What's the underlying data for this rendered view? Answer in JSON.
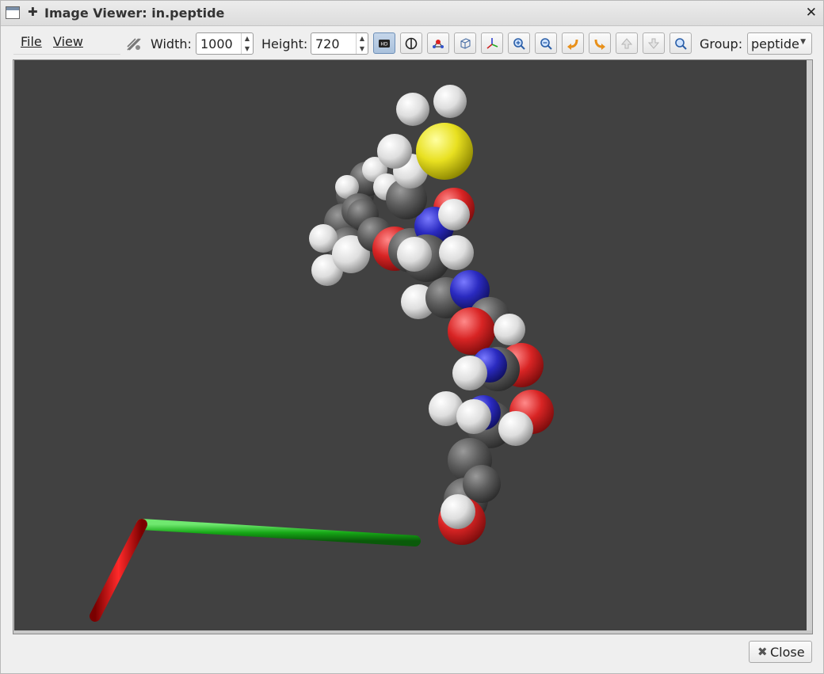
{
  "window": {
    "title": "Image Viewer: in.peptide"
  },
  "menu": {
    "file": "File",
    "view": "View"
  },
  "toolbar": {
    "width_label": "Width:",
    "width_value": "1000",
    "height_label": "Height:",
    "height_value": "720",
    "group_label": "Group:",
    "group_value": "peptide",
    "buttons": [
      "hd-icon",
      "contrast-icon",
      "atom-bond-icon",
      "box-icon",
      "axes-icon",
      "zoom-in-icon",
      "zoom-out-icon",
      "rotate-left-icon",
      "rotate-right-icon",
      "rotate-up-icon",
      "rotate-down-icon",
      "reset-view-icon"
    ],
    "active_button": "hd-icon"
  },
  "viewport": {
    "background": "#414141",
    "axis_colors": {
      "x": "#d40000",
      "y": "#15b815",
      "z": "#0a0ad6"
    },
    "atom_colors": {
      "carbon": "#5a5a5a",
      "hydrogen": "#e6e6e6",
      "oxygen": "#d82424",
      "nitrogen": "#2a2ac0",
      "sulfur": "#e8e020"
    }
  },
  "footer": {
    "close_label": "Close"
  }
}
